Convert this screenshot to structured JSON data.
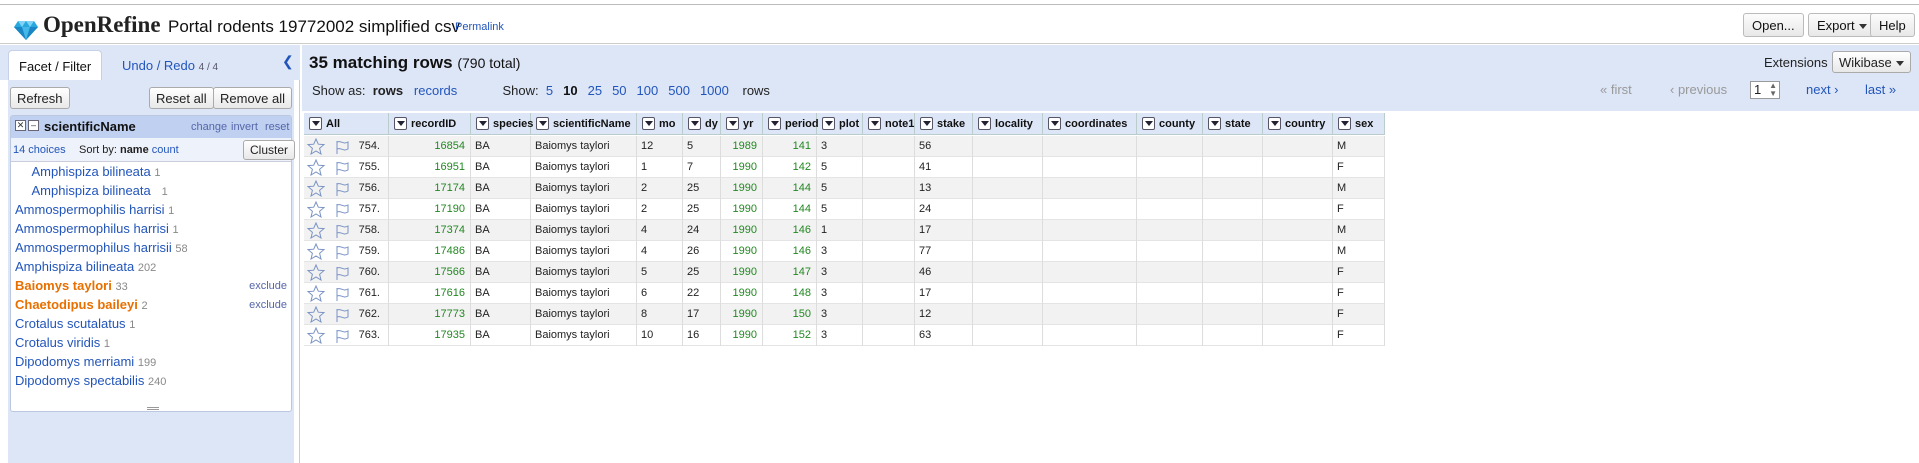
{
  "header": {
    "app_name": "OpenRefine",
    "project_name": "Portal rodents 19772002 simplified csv",
    "permalink": "Permalink",
    "open_label": "Open...",
    "export_label": "Export",
    "help_label": "Help"
  },
  "left": {
    "tab_facet": "Facet / Filter",
    "tab_undo": "Undo / Redo",
    "undo_count": "4 / 4",
    "refresh": "Refresh",
    "reset_all": "Reset all",
    "remove_all": "Remove all",
    "facet": {
      "name": "scientificName",
      "change": "change",
      "invert": "invert",
      "reset": "reset",
      "choices": "14 choices",
      "sort_by": "Sort by:",
      "sort_name": "name",
      "sort_count": "count",
      "cluster": "Cluster",
      "items": [
        {
          "name": "  Amphispiza bilineata",
          "count": "1",
          "selected": false
        },
        {
          "name": "  Amphispiza bilineata  ",
          "count": "1",
          "selected": false
        },
        {
          "name": "Ammospermophilis harrisi",
          "count": "1",
          "selected": false
        },
        {
          "name": "Ammospermophilus harrisi",
          "count": "1",
          "selected": false
        },
        {
          "name": "Ammospermophilus harrisii",
          "count": "58",
          "selected": false
        },
        {
          "name": "Amphispiza bilineata",
          "count": "202",
          "selected": false
        },
        {
          "name": "Baiomys taylori",
          "count": "33",
          "selected": true,
          "exclude": "exclude"
        },
        {
          "name": "Chaetodipus baileyi",
          "count": "2",
          "selected": true,
          "exclude": "exclude"
        },
        {
          "name": "Crotalus scutalatus",
          "count": "1",
          "selected": false
        },
        {
          "name": "Crotalus viridis",
          "count": "1",
          "selected": false
        },
        {
          "name": "Dipodomys merriami",
          "count": "199",
          "selected": false
        },
        {
          "name": "Dipodomys spectabilis",
          "count": "240",
          "selected": false
        }
      ]
    }
  },
  "main": {
    "matching": "35 matching rows",
    "total": "(790 total)",
    "extensions_label": "Extensions",
    "wikibase_label": "Wikibase",
    "show_as_label": "Show as:",
    "show_rows": "rows",
    "show_records": "records",
    "show_label": "Show:",
    "page_sizes": [
      "5",
      "10",
      "25",
      "50",
      "100",
      "500",
      "1000"
    ],
    "page_size_current": "10",
    "rows_suffix": "rows",
    "first": "« first",
    "previous": "‹ previous",
    "page": "1",
    "next": "next ›",
    "last": "last »"
  },
  "grid": {
    "columns": [
      "All",
      "recordID",
      "species",
      "scientificName",
      "mo",
      "dy",
      "yr",
      "period",
      "plot",
      "note1",
      "stake",
      "locality",
      "coordinates",
      "county",
      "state",
      "country",
      "sex"
    ],
    "rows": [
      {
        "idx": "754.",
        "recordID": "16854",
        "species": "BA",
        "scientificName": "Baiomys taylori",
        "mo": "12",
        "dy": "5",
        "yr": "1989",
        "period": "141",
        "plot": "3",
        "stake": "56",
        "sex": "M"
      },
      {
        "idx": "755.",
        "recordID": "16951",
        "species": "BA",
        "scientificName": "Baiomys taylori",
        "mo": "1",
        "dy": "7",
        "yr": "1990",
        "period": "142",
        "plot": "5",
        "stake": "41",
        "sex": "F"
      },
      {
        "idx": "756.",
        "recordID": "17174",
        "species": "BA",
        "scientificName": "Baiomys taylori",
        "mo": "2",
        "dy": "25",
        "yr": "1990",
        "period": "144",
        "plot": "5",
        "stake": "13",
        "sex": "M"
      },
      {
        "idx": "757.",
        "recordID": "17190",
        "species": "BA",
        "scientificName": "Baiomys taylori",
        "mo": "2",
        "dy": "25",
        "yr": "1990",
        "period": "144",
        "plot": "5",
        "stake": "24",
        "sex": "F"
      },
      {
        "idx": "758.",
        "recordID": "17374",
        "species": "BA",
        "scientificName": "Baiomys taylori",
        "mo": "4",
        "dy": "24",
        "yr": "1990",
        "period": "146",
        "plot": "1",
        "stake": "17",
        "sex": "M"
      },
      {
        "idx": "759.",
        "recordID": "17486",
        "species": "BA",
        "scientificName": "Baiomys taylori",
        "mo": "4",
        "dy": "26",
        "yr": "1990",
        "period": "146",
        "plot": "3",
        "stake": "77",
        "sex": "M"
      },
      {
        "idx": "760.",
        "recordID": "17566",
        "species": "BA",
        "scientificName": "Baiomys taylori",
        "mo": "5",
        "dy": "25",
        "yr": "1990",
        "period": "147",
        "plot": "3",
        "stake": "46",
        "sex": "F"
      },
      {
        "idx": "761.",
        "recordID": "17616",
        "species": "BA",
        "scientificName": "Baiomys taylori",
        "mo": "6",
        "dy": "22",
        "yr": "1990",
        "period": "148",
        "plot": "3",
        "stake": "17",
        "sex": "F"
      },
      {
        "idx": "762.",
        "recordID": "17773",
        "species": "BA",
        "scientificName": "Baiomys taylori",
        "mo": "8",
        "dy": "17",
        "yr": "1990",
        "period": "150",
        "plot": "3",
        "stake": "12",
        "sex": "F"
      },
      {
        "idx": "763.",
        "recordID": "17935",
        "species": "BA",
        "scientificName": "Baiomys taylori",
        "mo": "10",
        "dy": "16",
        "yr": "1990",
        "period": "152",
        "plot": "3",
        "stake": "63",
        "sex": "F"
      }
    ]
  },
  "colors": {
    "accent_blue": "#2255bb",
    "panel_bg": "#dde6f7",
    "number_green": "#228822",
    "selected_orange": "#e87000"
  }
}
